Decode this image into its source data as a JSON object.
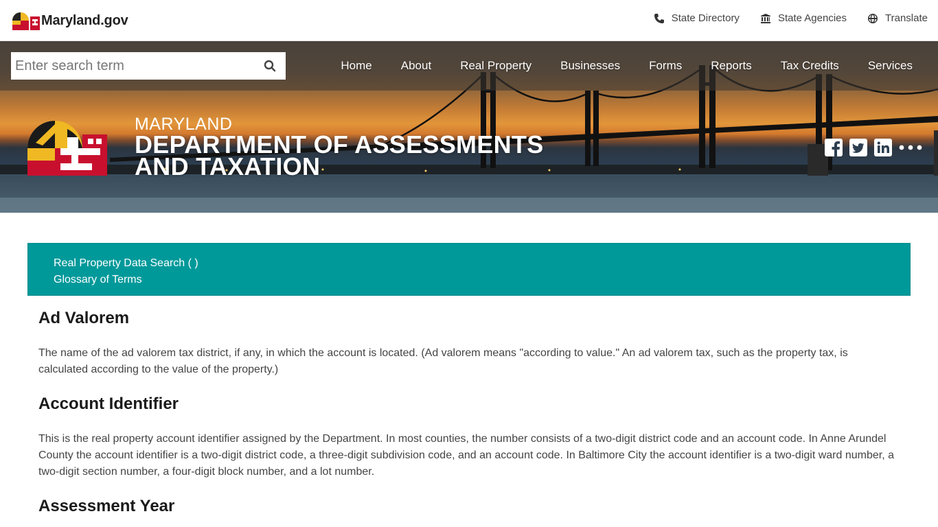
{
  "header": {
    "logo_text": "Maryland.gov",
    "utility_links": [
      {
        "label": "State Directory",
        "icon": "phone-icon"
      },
      {
        "label": "State Agencies",
        "icon": "building-icon"
      },
      {
        "label": "Translate",
        "icon": "globe-icon"
      }
    ]
  },
  "search": {
    "placeholder": "Enter search term"
  },
  "nav": {
    "items": [
      "Home",
      "About",
      "Real Property",
      "Businesses",
      "Forms",
      "Reports",
      "Tax Credits",
      "Services"
    ]
  },
  "agency": {
    "super_title": "MARYLAND",
    "name_line1": "DEPARTMENT OF ASSESSMENTS",
    "name_line2": "AND TAXATION"
  },
  "social": [
    "facebook-icon",
    "twitter-icon",
    "linkedin-icon",
    "more-icon"
  ],
  "breadcrumbs": [
    "Real Property Data Search ( )",
    "Glossary of Terms"
  ],
  "glossary": [
    {
      "term": "Ad Valorem",
      "definition": "The name of the ad valorem tax district, if any, in which the account is located. (Ad valorem means \"according to value.\" An ad valorem tax, such as the property tax, is calculated according to the value of the property.)"
    },
    {
      "term": "Account Identifier",
      "definition": "This is the real property account identifier assigned by the Department. In most counties, the number consists of a two-digit district code and an account code. In Anne Arundel County the account identifier is a two-digit district code, a three-digit subdivision code, and an account code. In Baltimore City the account identifier is a two-digit ward number, a two-digit section number, a four-digit block number, and a lot number."
    },
    {
      "term": "Assessment Year",
      "definition": ""
    }
  ],
  "colors": {
    "teal": "#00999a",
    "flag_gold": "#f0b823",
    "flag_red": "#c8102e"
  }
}
